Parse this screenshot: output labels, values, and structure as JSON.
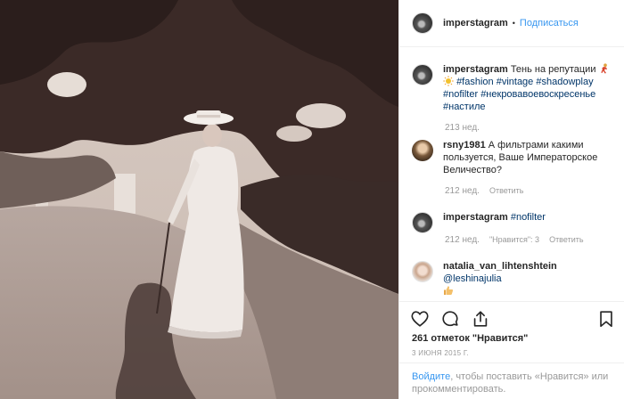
{
  "post": {
    "author": "imperstagram",
    "follow_label": "Подписаться",
    "separator": "•",
    "photo_alt": "Архивная фотография: женщина в белом платье с тростью на парковой дорожке"
  },
  "caption": {
    "user": "imperstagram",
    "text": "Тень на репутации",
    "tags_line1": "#fashion #vintage #shadowplay",
    "tags_line2": "#nofilter #некровавоевоскресенье",
    "tags_line3": "#настиле",
    "time": "213 нед."
  },
  "comments": [
    {
      "user": "rsny1981",
      "text": "А фильтрами какими пользуется, Ваше Императорское Величество?",
      "time": "212 нед.",
      "reply": "Ответить"
    },
    {
      "user": "imperstagram",
      "tag": "#nofilter",
      "time": "212 нед.",
      "likes": "\"Нравится\": 3",
      "reply": "Ответить"
    },
    {
      "user": "natalia_van_lihtenshtein",
      "mention": "@leshinajulia"
    }
  ],
  "actions": {
    "likes": "261 отметок \"Нравится\"",
    "date": "3 ИЮНЯ 2015 Г.",
    "login_link": "Войдите",
    "login_text": ", чтобы поставить «Нравится» или прокомментировать."
  },
  "icons": {
    "like": "heart-icon",
    "comment": "comment-icon",
    "share": "share-icon",
    "save": "bookmark-icon"
  },
  "colors": {
    "link": "#3897f0",
    "hashtag": "#003569",
    "muted": "#999999",
    "border": "#efefef"
  }
}
